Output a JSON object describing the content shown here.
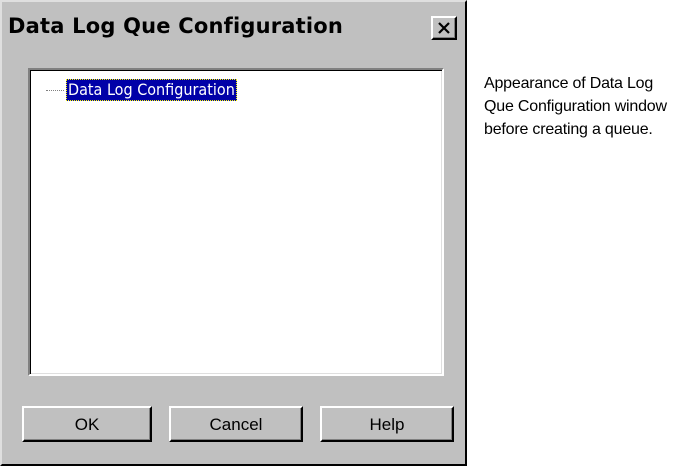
{
  "window": {
    "title": "Data Log Que Configuration",
    "close_icon": "close-icon"
  },
  "tree": {
    "nodes": [
      {
        "label": "Data Log Configuration",
        "selected": true
      }
    ]
  },
  "buttons": {
    "ok_label": "OK",
    "cancel_label": "Cancel",
    "help_label": "Help"
  },
  "caption": {
    "text": "Appearance of Data Log Que Configuration window before creating a queue."
  },
  "colors": {
    "dialog_face": "#c0c0c0",
    "selection_bg": "#0000a8",
    "selection_text": "#ffffff"
  }
}
